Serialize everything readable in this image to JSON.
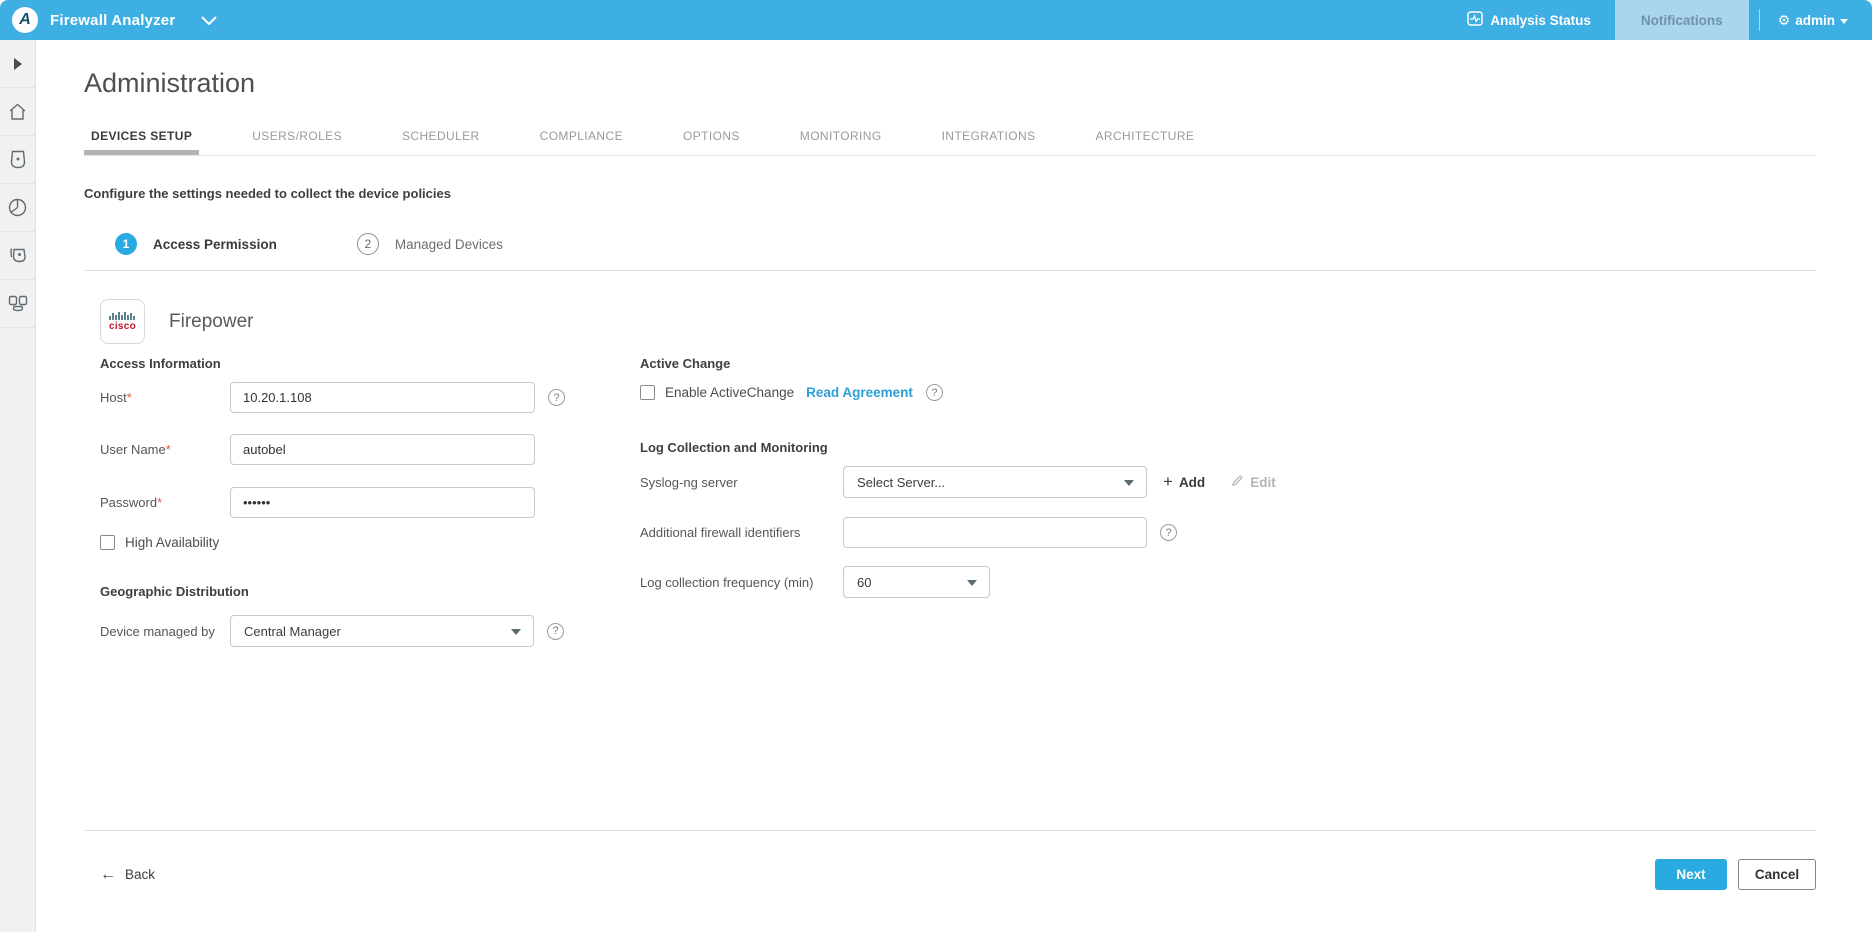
{
  "header": {
    "app_title": "Firewall Analyzer",
    "analysis_status_label": "Analysis Status",
    "notifications_label": "Notifications",
    "user_label": "admin"
  },
  "sidebar": {
    "items": [
      {
        "icon": "expand-arrow-icon"
      },
      {
        "icon": "home-icon"
      },
      {
        "icon": "device-icon"
      },
      {
        "icon": "clock-report-icon"
      },
      {
        "icon": "devices-copy-icon"
      },
      {
        "icon": "device-group-icon"
      }
    ]
  },
  "page": {
    "title": "Administration",
    "description": "Configure the settings needed to collect the device policies"
  },
  "tabs": [
    {
      "label": "DEVICES SETUP",
      "active": true
    },
    {
      "label": "USERS/ROLES",
      "active": false
    },
    {
      "label": "SCHEDULER",
      "active": false
    },
    {
      "label": "COMPLIANCE",
      "active": false
    },
    {
      "label": "OPTIONS",
      "active": false
    },
    {
      "label": "MONITORING",
      "active": false
    },
    {
      "label": "INTEGRATIONS",
      "active": false
    },
    {
      "label": "ARCHITECTURE",
      "active": false
    }
  ],
  "steps": [
    {
      "number": "1",
      "label": "Access Permission",
      "state": "current"
    },
    {
      "number": "2",
      "label": "Managed Devices",
      "state": "upcoming"
    }
  ],
  "device": {
    "brand_word": "cisco",
    "name": "Firepower"
  },
  "access_information": {
    "heading": "Access Information",
    "required_marker": "*",
    "host_label": "Host",
    "host_value": "10.20.1.108",
    "username_label": "User Name",
    "username_value": "autobel",
    "password_label": "Password",
    "password_value": "••••••",
    "high_availability_label": "High Availability",
    "high_availability_checked": false
  },
  "geographic_distribution": {
    "heading": "Geographic Distribution",
    "managed_by_label": "Device managed by",
    "managed_by_value": "Central Manager"
  },
  "active_change": {
    "heading": "Active Change",
    "enable_label": "Enable ActiveChange",
    "enable_checked": false,
    "read_agreement_label": "Read Agreement"
  },
  "log_collection": {
    "heading": "Log Collection and Monitoring",
    "syslog_label": "Syslog-ng server",
    "syslog_value": "Select Server...",
    "add_label": "Add",
    "edit_label": "Edit",
    "identifiers_label": "Additional firewall identifiers",
    "identifiers_value": "",
    "frequency_label": "Log collection frequency (min)",
    "frequency_value": "60"
  },
  "footer": {
    "back_label": "Back",
    "next_label": "Next",
    "cancel_label": "Cancel"
  },
  "colors": {
    "header_blue": "#3dafe3",
    "accent_blue": "#29abe2",
    "link_blue": "#2b9fd8",
    "notifications_bg": "#a9d6ee",
    "cisco_red": "#c4122e"
  }
}
